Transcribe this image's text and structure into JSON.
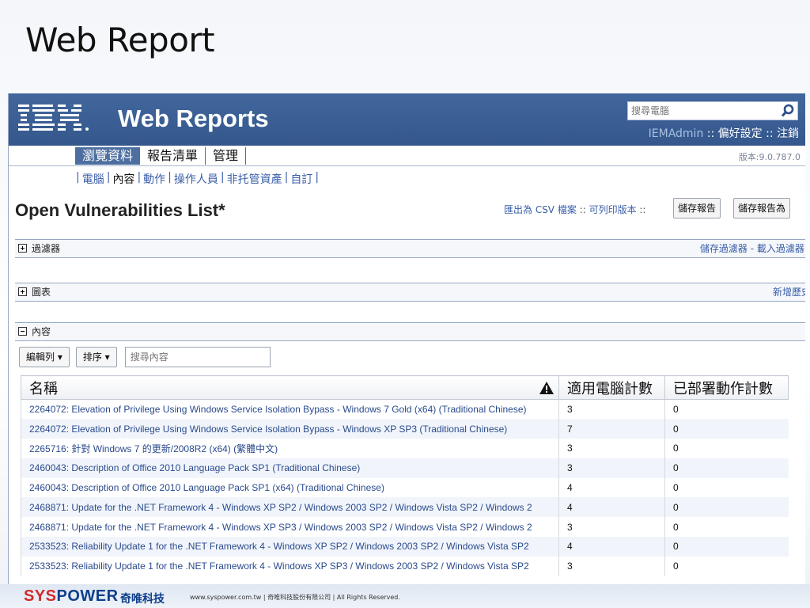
{
  "slide_title": "Web Report",
  "app": {
    "logo_text": "IBM.",
    "title": "Web Reports",
    "search_placeholder": "搜尋電腦",
    "user": {
      "name": "IEMAdmin",
      "sep1": " :: ",
      "prefs": "偏好設定",
      "sep2": " :: ",
      "logout": "注銷"
    },
    "version": "版本:9.0.787.0",
    "nav_tabs": [
      "瀏覽資料",
      "報告清單",
      "管理"
    ],
    "subnav": [
      "電腦",
      "內容",
      "動作",
      "操作人員",
      "非托管資產",
      "自訂"
    ],
    "report": {
      "title": "Open Vulnerabilities List*",
      "export_csv": "匯出為 CSV 檔案",
      "printable": "可列印版本",
      "action_sep": " :: ",
      "save_btn": "儲存報告",
      "save_as_btn": "儲存報告為"
    },
    "sections": {
      "filter": {
        "label": "過濾器",
        "right": "儲存過濾器 - 載入過濾器 -"
      },
      "chart": {
        "label": "圖表",
        "right": "新增歷史"
      },
      "content": {
        "label": "內容"
      }
    },
    "toolbar": {
      "edit_columns": "編輯列 ▾",
      "sort": "排序 ▾",
      "search_placeholder": "搜尋內容"
    },
    "table": {
      "headers": [
        "名稱",
        "適用電腦計數",
        "已部署動作計數"
      ],
      "rows": [
        [
          "2264072: Elevation of Privilege Using Windows Service Isolation Bypass - Windows 7 Gold (x64) (Traditional Chinese)",
          "3",
          "0"
        ],
        [
          "2264072: Elevation of Privilege Using Windows Service Isolation Bypass - Windows XP SP3 (Traditional Chinese)",
          "7",
          "0"
        ],
        [
          "2265716: 針對 Windows 7 的更新/2008R2 (x64) (繁體中文)",
          "3",
          "0"
        ],
        [
          "2460043: Description of Office 2010 Language Pack SP1 (Traditional Chinese)",
          "3",
          "0"
        ],
        [
          "2460043: Description of Office 2010 Language Pack SP1 (x64) (Traditional Chinese)",
          "4",
          "0"
        ],
        [
          "2468871: Update for the .NET Framework 4 - Windows XP SP2 / Windows 2003 SP2 / Windows Vista SP2 / Windows 2",
          "4",
          "0"
        ],
        [
          "2468871: Update for the .NET Framework 4 - Windows XP SP3 / Windows 2003 SP2 / Windows Vista SP2 / Windows 2",
          "3",
          "0"
        ],
        [
          "2533523: Reliability Update 1 for the .NET Framework 4 - Windows XP SP2 / Windows 2003 SP2 / Windows Vista SP2",
          "4",
          "0"
        ],
        [
          "2533523: Reliability Update 1 for the .NET Framework 4 - Windows XP SP3 / Windows 2003 SP2 / Windows Vista SP2",
          "3",
          "0"
        ]
      ]
    }
  },
  "footer": {
    "brand_a": "SYS",
    "brand_b": "POWER",
    "brand_cn": "奇唯科技",
    "copyright": "www.syspower.com.tw  |  奇唯科技股份有限公司  |  All Rights Reserved."
  },
  "colors": {
    "header_blue": "#3a5e93",
    "link_blue": "#3a5ea8",
    "brand_blue": "#0e3f8a",
    "brand_red": "#d42a2a"
  }
}
